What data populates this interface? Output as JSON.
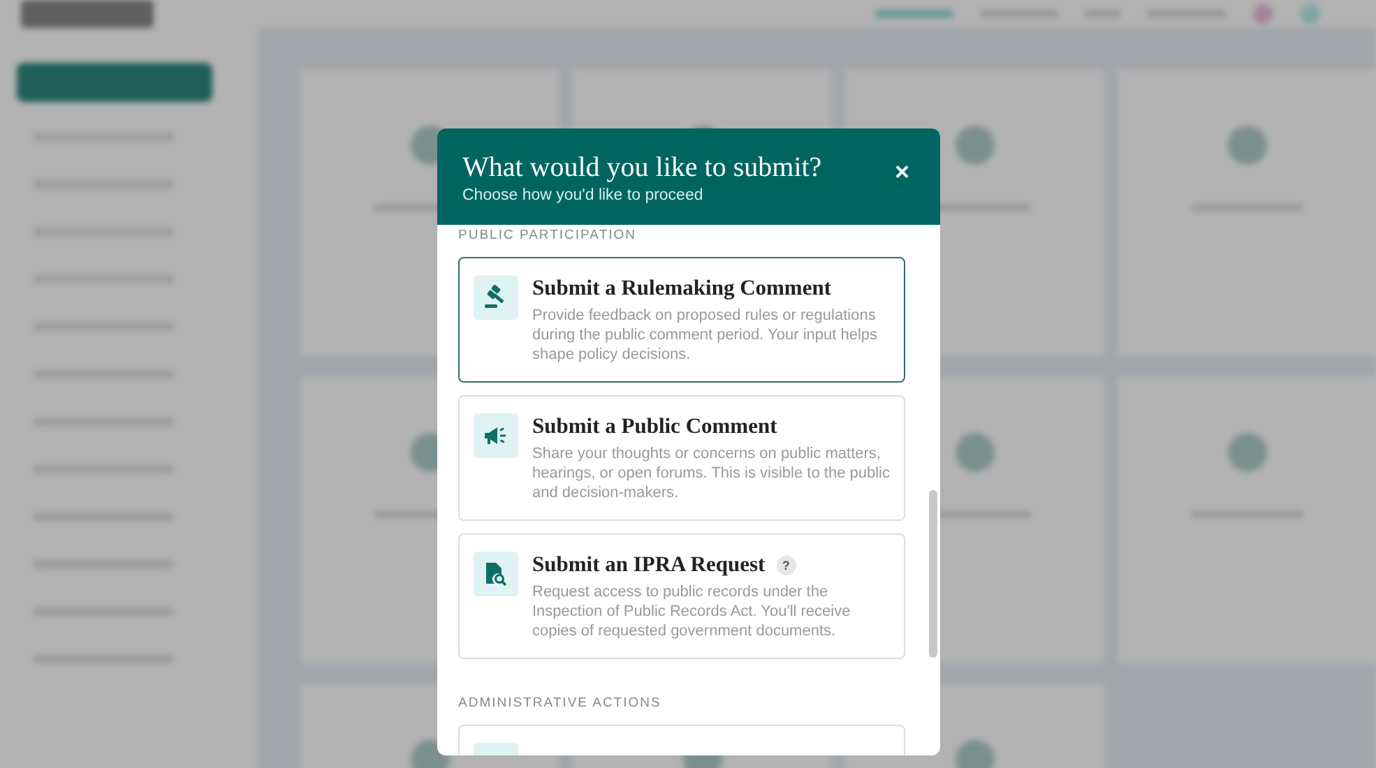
{
  "modal": {
    "title": "What would you like to submit?",
    "subtitle": "Choose how you'd like to proceed",
    "close": "×",
    "sections": [
      {
        "heading": "PUBLIC PARTICIPATION",
        "cards": [
          {
            "kind": "gavel",
            "title": "Submit a Rulemaking Comment",
            "description": "Provide feedback on proposed rules or regulations during the public comment period. Your input helps shape policy decisions.",
            "selected": true
          },
          {
            "kind": "megaphone",
            "title": "Submit a Public Comment",
            "description": "Share your thoughts or concerns on public matters, hearings, or open forums. This is visible to the public and decision-makers.",
            "selected": false
          },
          {
            "kind": "records",
            "title": "Submit an IPRA Request",
            "help": "?",
            "description": "Request access to public records under the Inspection of Public Records Act. You'll receive copies of requested government documents.",
            "selected": false
          }
        ]
      },
      {
        "heading": "ADMINISTRATIVE ACTIONS",
        "cards": [
          {
            "kind": "blank",
            "selected": false
          }
        ]
      }
    ]
  }
}
